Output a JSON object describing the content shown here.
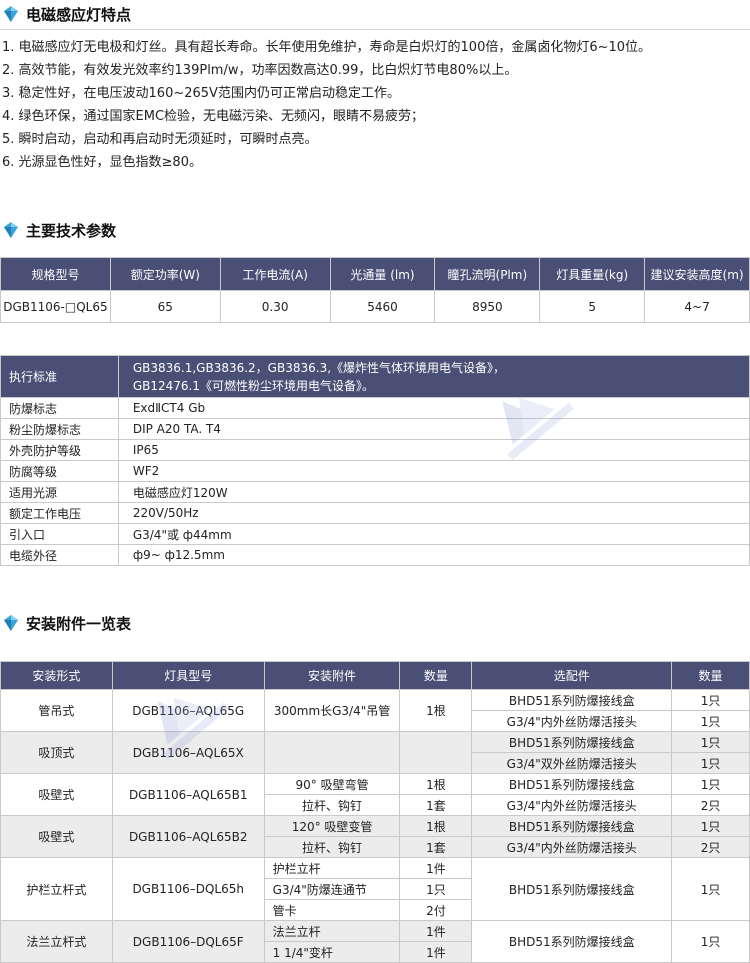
{
  "sections": {
    "features_title": "电磁感应灯特点",
    "params_title": "主要技术参数",
    "accessories_title": "安装附件一览表"
  },
  "features": [
    "1. 电磁感应灯无电极和灯丝。具有超长寿命。长年使用免维护，寿命是白炽灯的100倍，金属卤化物灯6~10位。",
    "2. 高效节能，有效发光效率约139Plm/w，功率因数高达0.99，比白炽灯节电80%以上。",
    "3. 稳定性好，在电压波动160~265V范围内仍可正常启动稳定工作。",
    "4. 绿色环保，通过国家EMC检验，无电磁污染、无频闪，眼睛不易疲劳；",
    "5. 瞬时启动，启动和再启动时无须延时，可瞬时点亮。",
    "6. 光源显色性好，显色指数≥80。"
  ],
  "params_table": {
    "headers": [
      "规格型号",
      "额定功率(W)",
      "工作电流(A)",
      "光通量 (lm)",
      "瞳孔流明(Plm)",
      "灯具重量(kg)",
      "建议安装高度(m)"
    ],
    "row": [
      "DGB1106-□QL65",
      "65",
      "0.30",
      "5460",
      "8950",
      "5",
      "4~7"
    ]
  },
  "spec_table": {
    "standard_label": "执行标准",
    "standard_value_1": "GB3836.1,GB3836.2，GB3836.3,《爆炸性气体环境用电气设备》，",
    "standard_value_2": "GB12476.1《可燃性粉尘环境用电气设备》。",
    "rows": [
      [
        "防爆标志",
        "ExdⅡCT4  Gb"
      ],
      [
        "粉尘防爆标志",
        "DIP A20 TA. T4"
      ],
      [
        "外壳防护等级",
        "IP65"
      ],
      [
        "防腐等级",
        "WF2"
      ],
      [
        "适用光源",
        "电磁感应灯120W"
      ],
      [
        "额定工作电压",
        "220V/50Hz"
      ],
      [
        "引入口",
        "G3/4\"或 ф44mm"
      ],
      [
        "电缆外径",
        "ф9~ ф12.5mm"
      ]
    ]
  },
  "acc_table": {
    "headers": [
      "安装形式",
      "灯具型号",
      "安装附件",
      "数量",
      "选配件",
      "数量"
    ],
    "groups": [
      {
        "form": "管吊式",
        "model": "DGB1106–AQL65G",
        "accs": [
          [
            "300mm长G3/4\"吊管",
            "1根"
          ]
        ],
        "opts": [
          [
            "BHD51系列防爆接线盒",
            "1只"
          ],
          [
            "G3/4\"内外丝防爆活接头",
            "1只"
          ]
        ]
      },
      {
        "form": "吸顶式",
        "model": "DGB1106–AQL65X",
        "accs": [
          [
            "",
            ""
          ]
        ],
        "opts": [
          [
            "BHD51系列防爆接线盒",
            "1只"
          ],
          [
            "G3/4\"双外丝防爆活接头",
            "1只"
          ]
        ]
      },
      {
        "form": "吸壁式",
        "model": "DGB1106–AQL65B1",
        "accs": [
          [
            "90°  吸壁弯管",
            "1根"
          ],
          [
            "拉杆、钩钉",
            "1套"
          ]
        ],
        "opts": [
          [
            "BHD51系列防爆接线盒",
            "1只"
          ],
          [
            "G3/4\"内外丝防爆活接头",
            "2只"
          ]
        ]
      },
      {
        "form": "吸壁式",
        "model": "DGB1106–AQL65B2",
        "accs": [
          [
            "120°  吸壁变管",
            "1根"
          ],
          [
            "拉杆、钩钉",
            "1套"
          ]
        ],
        "opts": [
          [
            "BHD51系列防爆接线盒",
            "1只"
          ],
          [
            "G3/4\"内外丝防爆活接头",
            "2只"
          ]
        ]
      },
      {
        "form": "护栏立杆式",
        "model": "DGB1106–DQL65h",
        "accs": [
          [
            "护栏立杆",
            "1件"
          ],
          [
            "G3/4\"防爆连通节",
            "1只"
          ],
          [
            "管卡",
            "2付"
          ]
        ],
        "opts": [
          [
            "BHD51系列防爆接线盒",
            "1只"
          ]
        ]
      },
      {
        "form": "法兰立杆式",
        "model": "DGB1106–DQL65F",
        "accs": [
          [
            "法兰立杆",
            "1件"
          ],
          [
            "1 1/4\"变杆",
            "1件"
          ]
        ],
        "opts": [
          [
            "BHD51系列防爆接线盒",
            "1只"
          ]
        ]
      }
    ]
  },
  "colors": {
    "header_bg": "#4a5075",
    "gem": "#3aa3d9"
  }
}
